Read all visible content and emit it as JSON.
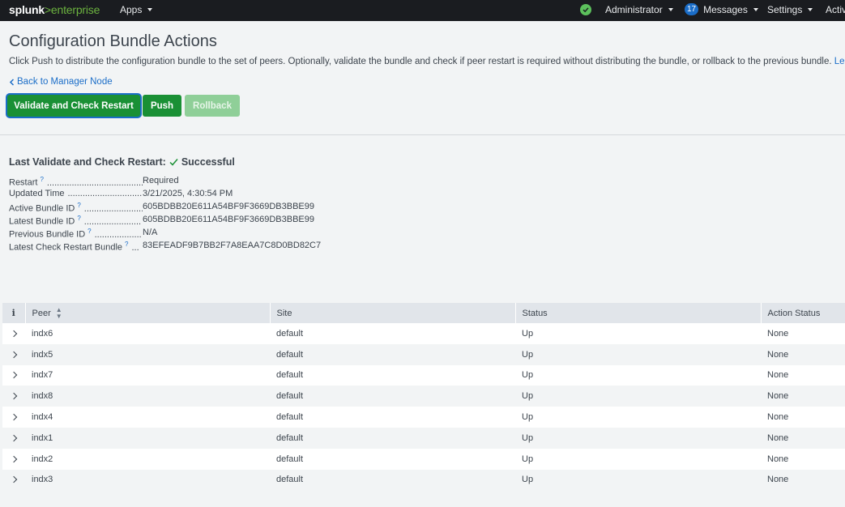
{
  "topbar": {
    "logo_splunk": "splunk",
    "logo_gt": ">",
    "logo_enterprise": "enterprise",
    "apps": "Apps",
    "user": "Administrator",
    "messages_count": "17",
    "messages": "Messages",
    "settings": "Settings",
    "activity": "Activ"
  },
  "page": {
    "title": "Configuration Bundle Actions",
    "description": "Click Push to distribute the configuration bundle to the set of peers. Optionally, validate the bundle and check if peer restart is required without distributing the bundle, or rollback to the previous bundle.",
    "learn_more": "Learn M",
    "back_link": "Back to Manager Node"
  },
  "buttons": {
    "validate": "Validate and Check Restart",
    "push": "Push",
    "rollback": "Rollback"
  },
  "last_check": {
    "title": "Last Validate and Check Restart:",
    "result": "Successful",
    "rows": [
      {
        "key": "Restart",
        "help": "?",
        "dots": ".........................................",
        "value": "Required"
      },
      {
        "key": "Updated Time",
        "help": "",
        "dots": ".................................",
        "value": "3/21/2025, 4:30:54 PM"
      },
      {
        "key": "Active Bundle ID",
        "help": "?",
        "dots": ".........................",
        "value": "605BDBB20E611A54BF9F3669DB3BBE99"
      },
      {
        "key": "Latest Bundle ID",
        "help": "?",
        "dots": ".......................",
        "value": "605BDBB20E611A54BF9F3669DB3BBE99"
      },
      {
        "key": "Previous Bundle ID",
        "help": "?",
        "dots": "...................",
        "value": "N/A"
      },
      {
        "key": "Latest Check Restart Bundle",
        "help": "?",
        "dots": "...",
        "value": "83EFEADF9B7BB2F7A8EAA7C8D0BD82C7"
      }
    ]
  },
  "table": {
    "info_col": "i",
    "columns": [
      "Peer",
      "Site",
      "Status",
      "Action Status"
    ],
    "rows": [
      {
        "peer": "indx6",
        "site": "default",
        "status": "Up",
        "action": "None"
      },
      {
        "peer": "indx5",
        "site": "default",
        "status": "Up",
        "action": "None"
      },
      {
        "peer": "indx7",
        "site": "default",
        "status": "Up",
        "action": "None"
      },
      {
        "peer": "indx8",
        "site": "default",
        "status": "Up",
        "action": "None"
      },
      {
        "peer": "indx4",
        "site": "default",
        "status": "Up",
        "action": "None"
      },
      {
        "peer": "indx1",
        "site": "default",
        "status": "Up",
        "action": "None"
      },
      {
        "peer": "indx2",
        "site": "default",
        "status": "Up",
        "action": "None"
      },
      {
        "peer": "indx3",
        "site": "default",
        "status": "Up",
        "action": "None"
      }
    ]
  },
  "icons": {
    "health": "check-circle-icon",
    "success": "checkmark-icon",
    "back": "chevron-left-icon",
    "expand": "chevron-right-icon",
    "sort": "sort-icon"
  },
  "colors": {
    "topbar": "#1a1c20",
    "brand_green": "#6cb33f",
    "button_green": "#1a9035",
    "link_blue": "#1a6dc8",
    "health_green": "#5cc05c"
  }
}
